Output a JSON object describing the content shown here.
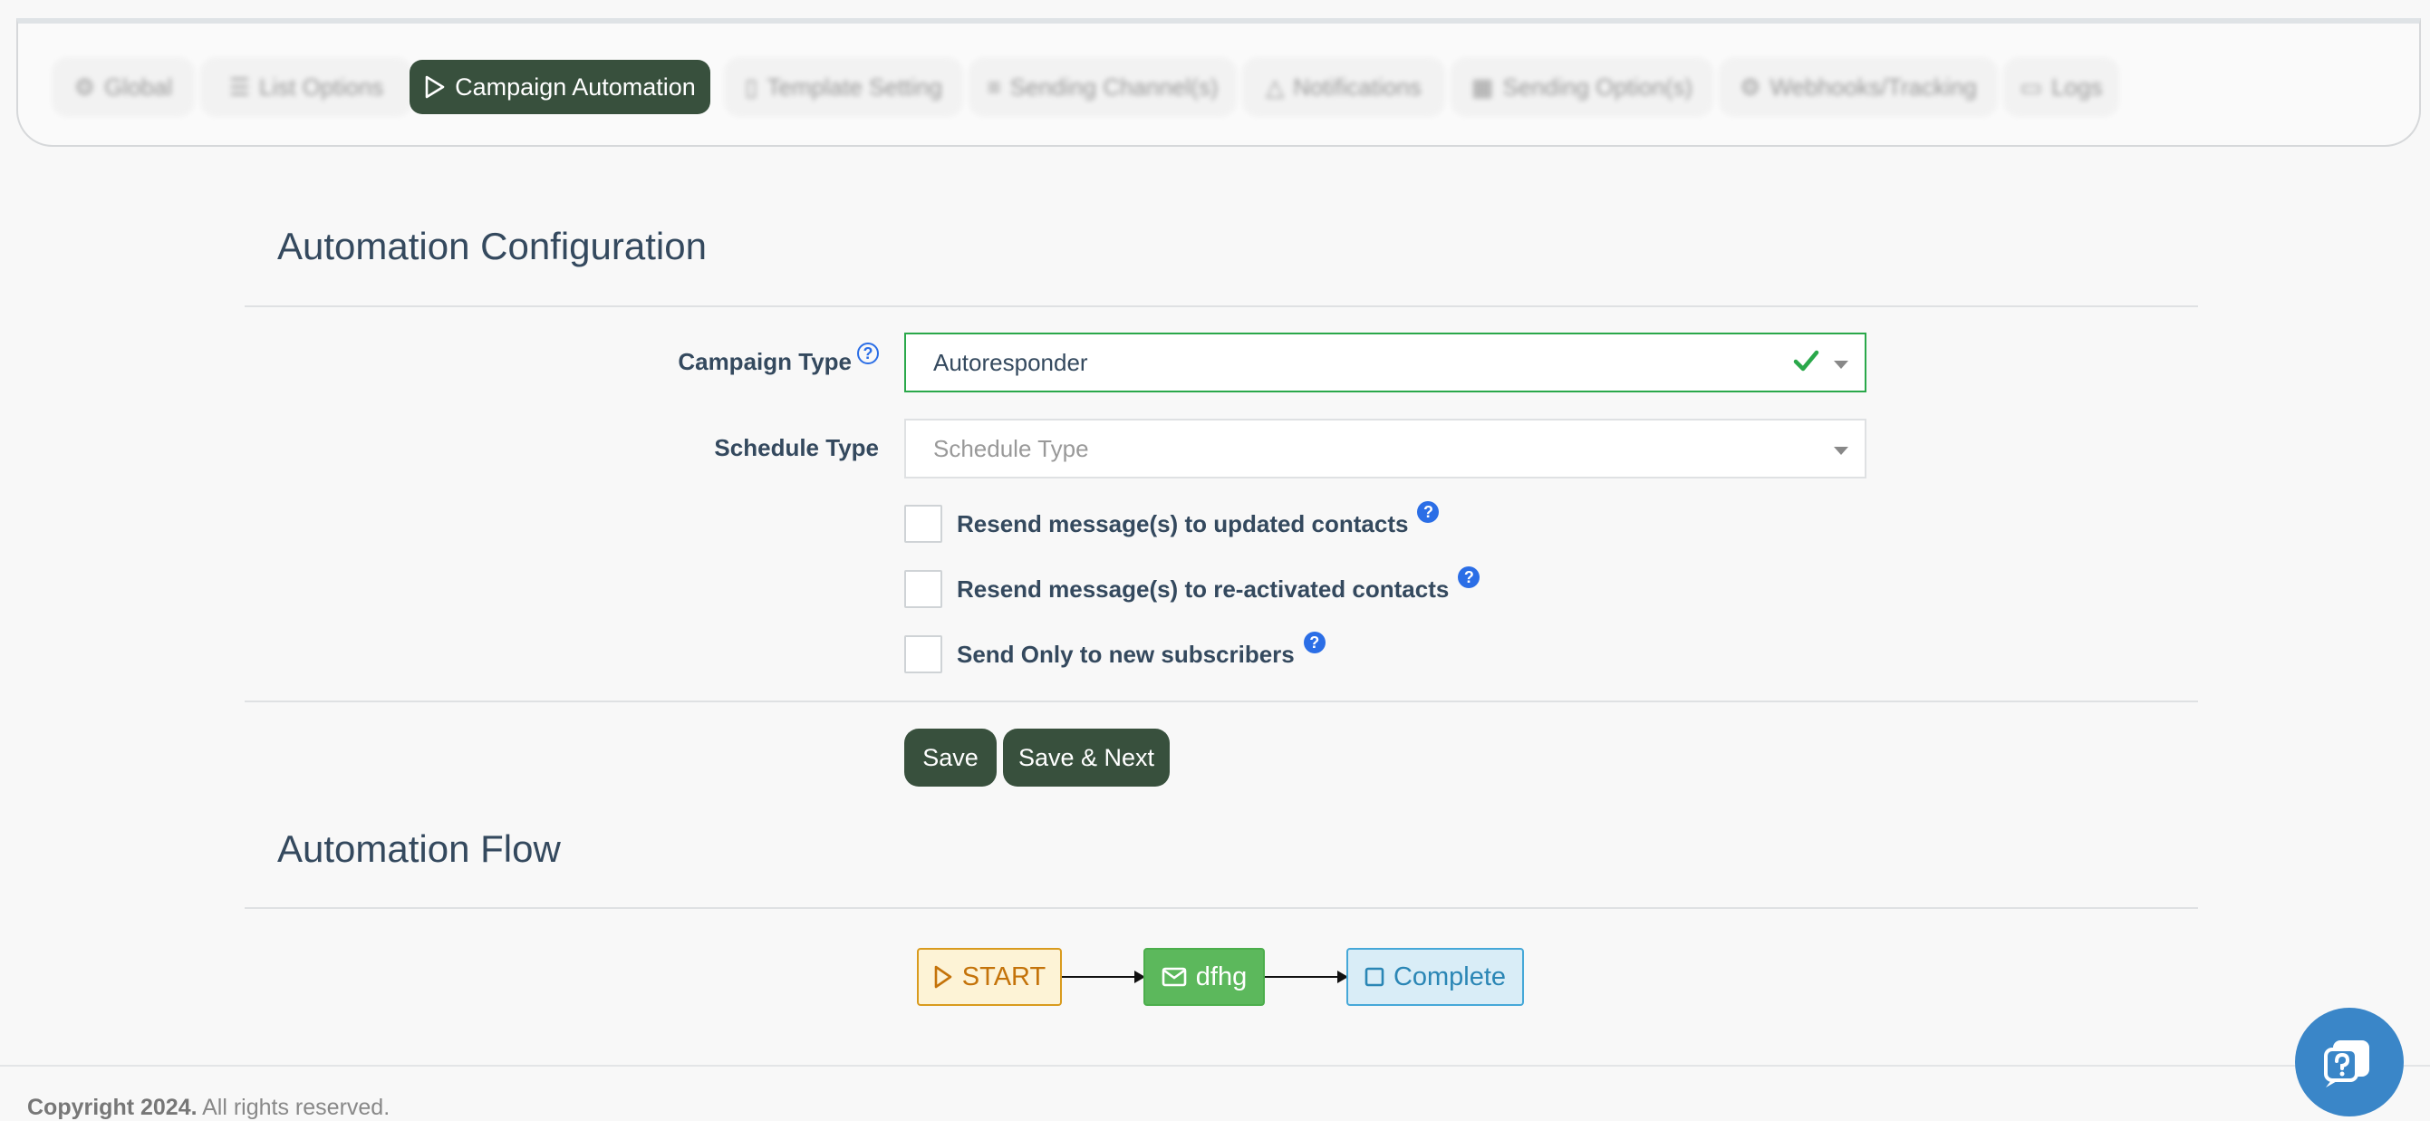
{
  "tabs": [
    {
      "label": "Global",
      "icon": "sliders-icon"
    },
    {
      "label": "List Options",
      "icon": "users-icon"
    },
    {
      "label": "Campaign Automation",
      "icon": "play-icon"
    },
    {
      "label": "Template Setting",
      "icon": "file-icon"
    },
    {
      "label": "Sending Channel(s)",
      "icon": "channels-icon"
    },
    {
      "label": "Notifications",
      "icon": "bell-icon"
    },
    {
      "label": "Sending Option(s)",
      "icon": "calendar-icon"
    },
    {
      "label": "Webhooks/Tracking",
      "icon": "sliders-icon"
    },
    {
      "label": "Logs",
      "icon": "logs-icon"
    }
  ],
  "config": {
    "title": "Automation Configuration",
    "campaign_type_label": "Campaign Type",
    "campaign_type_value": "Autoresponder",
    "schedule_type_label": "Schedule Type",
    "schedule_type_placeholder": "Schedule Type",
    "checkboxes": [
      {
        "label": "Resend message(s) to updated contacts",
        "checked": false
      },
      {
        "label": "Resend message(s) to re-activated contacts",
        "checked": false
      },
      {
        "label": "Send Only to new subscribers",
        "checked": false
      }
    ],
    "save_label": "Save",
    "save_next_label": "Save & Next",
    "help_glyph": "?"
  },
  "flow": {
    "title": "Automation Flow",
    "start_label": "START",
    "email_label": "dfhg",
    "complete_label": "Complete"
  },
  "footer": {
    "copyright_strong": "Copyright 2024.",
    "copyright_rest": " All rights reserved."
  },
  "colors": {
    "accent": "#38503d",
    "valid": "#2aa84a",
    "help": "#2b6ee6",
    "chat": "#3a86c8"
  }
}
